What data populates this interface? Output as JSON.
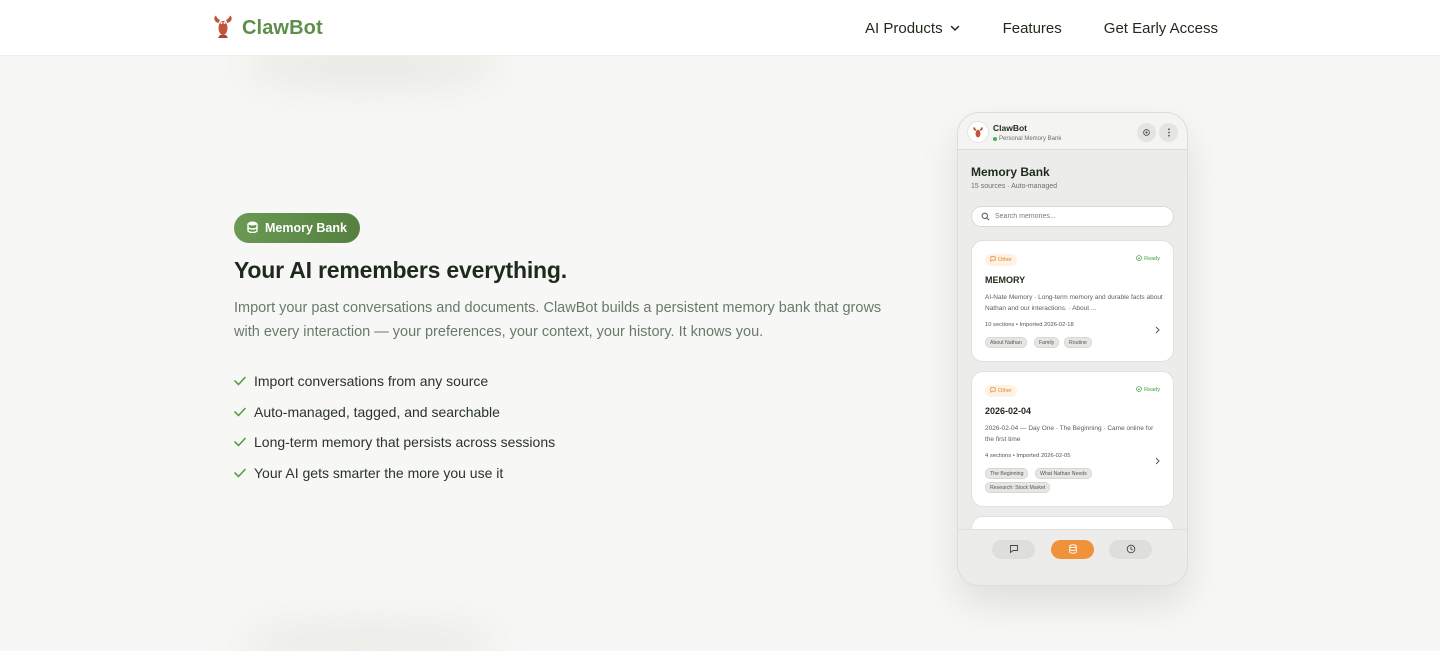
{
  "nav": {
    "brand": "ClawBot",
    "links": [
      "AI Products",
      "Features",
      "Get Early Access"
    ]
  },
  "hero": {
    "badge": "Memory Bank",
    "title": "Your AI remembers everything.",
    "description": "Import your past conversations and documents. ClawBot builds a persistent memory bank that grows with every interaction — your preferences, your context, your history. It knows you.",
    "features": [
      "Import conversations from any source",
      "Auto-managed, tagged, and searchable",
      "Long-term memory that persists across sessions",
      "Your AI gets smarter the more you use it"
    ]
  },
  "phone": {
    "app_name": "ClawBot",
    "app_sub": "Personal Memory Bank",
    "title": "Memory Bank",
    "meta": "15 sources · Auto-managed",
    "search_placeholder": "Search memories...",
    "cards": [
      {
        "type": "Other",
        "status": "Ready",
        "title": "MEMORY",
        "desc": "AI-Nate Memory · Long-term memory and durable facts about Nathan and our interactions. · About ...",
        "info": "10 sections • Imported 2026-02-18",
        "tags": [
          "About Nathan",
          "Family",
          "Routine"
        ]
      },
      {
        "type": "Other",
        "status": "Ready",
        "title": "2026-02-04",
        "desc": "2026-02-04 — Day One · The Beginning · Came online for the first time",
        "info": "4 sections • Imported 2026-02-05",
        "tags": [
          "The Beginning",
          "What Nathan Needs",
          "Research: Stock Market"
        ]
      }
    ]
  },
  "colors": {
    "brand_green": "#5e8f4a",
    "accent_orange": "#f0923a",
    "ready_green": "#43a047"
  }
}
